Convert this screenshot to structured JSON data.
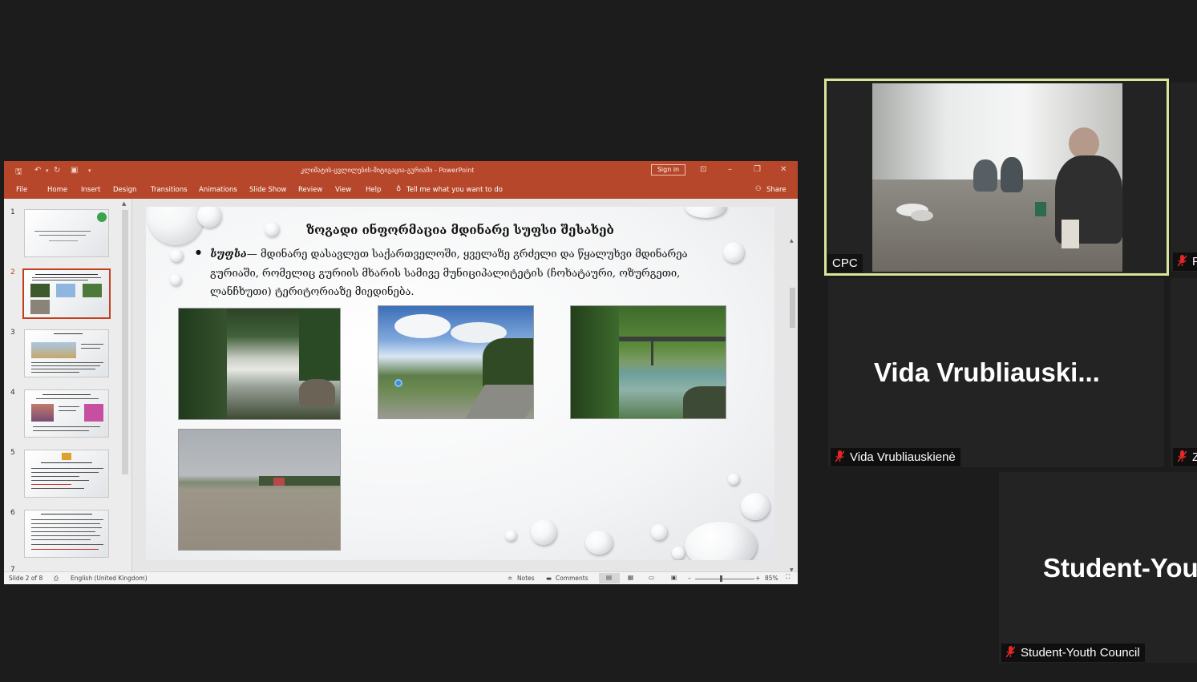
{
  "powerpoint": {
    "window_title": "კლიმატის-ცვლილების-მიტიგაცია-გურიაში  -  PowerPoint",
    "sign_in": "Sign in",
    "ribbon_tabs": [
      "File",
      "Home",
      "Insert",
      "Design",
      "Transitions",
      "Animations",
      "Slide Show",
      "Review",
      "View",
      "Help"
    ],
    "tell_me": "Tell me what you want to do",
    "share": "Share",
    "thumbnail_numbers": [
      "1",
      "2",
      "3",
      "4",
      "5",
      "6",
      "7"
    ],
    "selected_slide": 2,
    "slide": {
      "title": "ზოგადი ინფორმაცია მდინარე სუფსი შესახებ",
      "term": "სუფსა",
      "body": "— მდინარე დასავლეთ საქართველოში, ყველაზე გრძელი და წყალუხვი მდინარეა გურიაში, რომელიც გურიის მხარის სამივე მუნიციპალიტეტის (ჩოხატაური, ოზურგეთი, ლანჩხუთი) ტერიტორიაზე მიედინება."
    },
    "status": {
      "slide_counter": "Slide 2 of 8",
      "language": "English (United Kingdom)",
      "notes": "Notes",
      "comments": "Comments",
      "zoom": "85%"
    }
  },
  "participants": {
    "active": {
      "name": "CPC"
    },
    "tile_2": {
      "display_name": "Vida  Vrubliauski...",
      "name": "Vida Vrubliauskienė"
    },
    "tile_3": {
      "display_name": "Student-You",
      "name": "Student-Youth Council"
    },
    "partial_right_1": "F",
    "partial_right_2": "Z"
  },
  "colors": {
    "ppt_accent": "#b7472a",
    "active_speaker_border": "#d7e79a",
    "muted_mic": "#e02828",
    "background": "#1c1c1c"
  }
}
